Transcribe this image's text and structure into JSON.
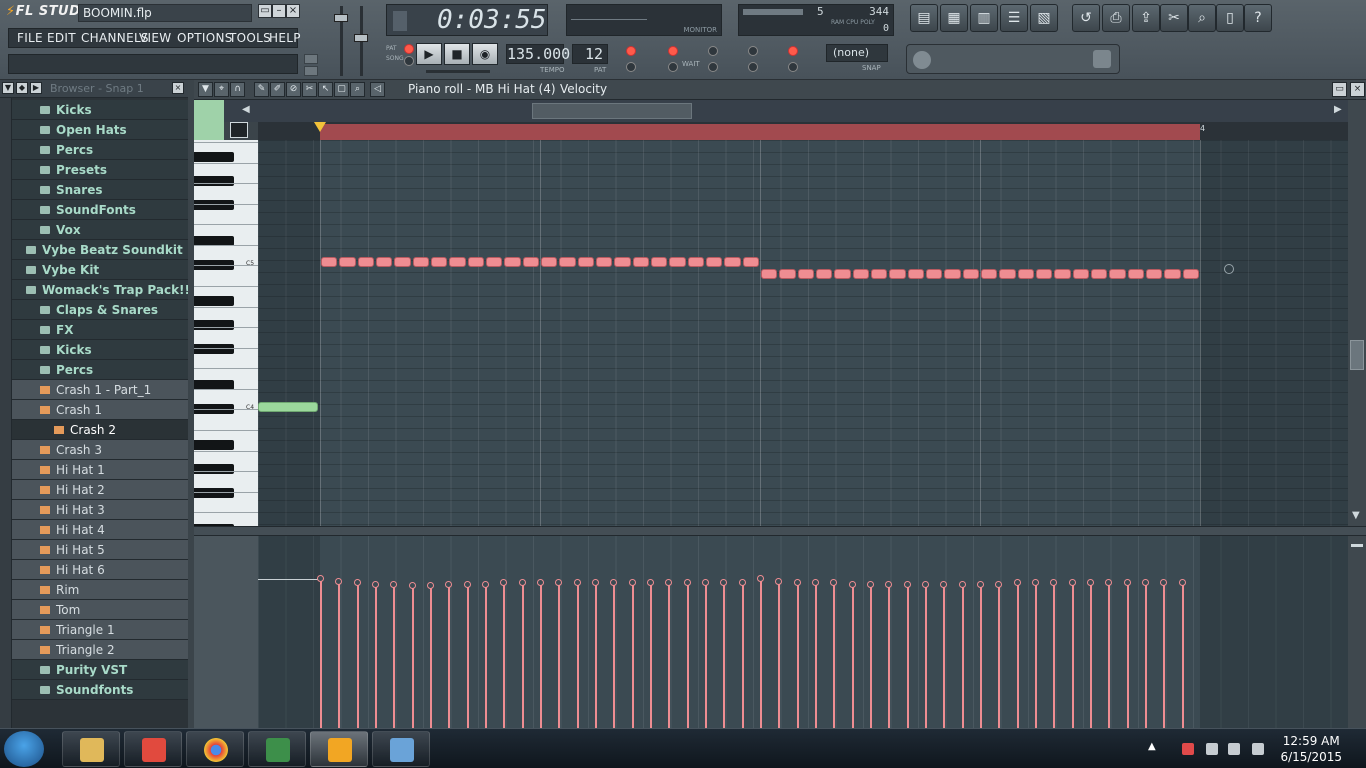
{
  "app": {
    "logo": "FL STUDIO",
    "project_title": "BOOMIN.flp",
    "window_controls": [
      "▭",
      "–",
      "×"
    ]
  },
  "menu": [
    "FILE",
    "EDIT",
    "CHANNELS",
    "VIEW",
    "OPTIONS",
    "TOOLS",
    "HELP"
  ],
  "display": {
    "time": "0:03:55",
    "monitor_label": "MONITOR",
    "cpu_value1": "5",
    "cpu_value2": "344",
    "cpu_value3": "0",
    "cpu_labels": "RAM  CPU  POLY"
  },
  "transport": {
    "modes": [
      "PAT",
      "SONG"
    ],
    "tempo": "135.000",
    "tempo_label": "TEMPO",
    "pattern": "12",
    "pattern_label": "PAT",
    "snap": "(none)",
    "snap_label": "SNAP",
    "wait_label": "WAIT"
  },
  "browser": {
    "title": "Browser - Snap 1",
    "items": [
      {
        "label": "Kicks",
        "type": "folder",
        "indent": 2
      },
      {
        "label": "Open Hats",
        "type": "folder",
        "indent": 2
      },
      {
        "label": "Percs",
        "type": "folder",
        "indent": 2
      },
      {
        "label": "Presets",
        "type": "folder",
        "indent": 2
      },
      {
        "label": "Snares",
        "type": "folder",
        "indent": 2
      },
      {
        "label": "SoundFonts",
        "type": "folder",
        "indent": 2
      },
      {
        "label": "Vox",
        "type": "folder",
        "indent": 2
      },
      {
        "label": "Vybe Beatz Soundkit",
        "type": "folder",
        "indent": 1
      },
      {
        "label": "Vybe Kit",
        "type": "folder",
        "indent": 1
      },
      {
        "label": "Womack's Trap Pack!!!",
        "type": "folder",
        "indent": 1
      },
      {
        "label": "Claps & Snares",
        "type": "folder",
        "indent": 2
      },
      {
        "label": "FX",
        "type": "folder",
        "indent": 2
      },
      {
        "label": "Kicks",
        "type": "folder",
        "indent": 2
      },
      {
        "label": "Percs",
        "type": "folder",
        "indent": 2
      },
      {
        "label": "Crash 1 - Part_1",
        "type": "file",
        "indent": 2
      },
      {
        "label": "Crash 1",
        "type": "file",
        "indent": 2
      },
      {
        "label": "Crash 2",
        "type": "file",
        "indent": 3,
        "selected": true
      },
      {
        "label": "Crash 3",
        "type": "file",
        "indent": 2
      },
      {
        "label": "Hi Hat 1",
        "type": "file",
        "indent": 2
      },
      {
        "label": "Hi Hat 2",
        "type": "file",
        "indent": 2
      },
      {
        "label": "Hi Hat 3",
        "type": "file",
        "indent": 2
      },
      {
        "label": "Hi Hat 4",
        "type": "file",
        "indent": 2
      },
      {
        "label": "Hi Hat 5",
        "type": "file",
        "indent": 2
      },
      {
        "label": "Hi Hat 6",
        "type": "file",
        "indent": 2
      },
      {
        "label": "Rim",
        "type": "file",
        "indent": 2
      },
      {
        "label": "Tom",
        "type": "file",
        "indent": 2
      },
      {
        "label": "Triangle 1",
        "type": "file",
        "indent": 2
      },
      {
        "label": "Triangle 2",
        "type": "file",
        "indent": 2
      },
      {
        "label": "Purity VST",
        "type": "folder",
        "indent": 2
      },
      {
        "label": "Soundfonts",
        "type": "folder",
        "indent": 2
      }
    ]
  },
  "piano_roll": {
    "title": "Piano roll - MB Hi Hat (4)",
    "target": "Velocity",
    "key_labels": [
      "C5",
      "C4"
    ],
    "timeline_marker": "4",
    "notes_high_count": 24,
    "notes_low_count": 24,
    "velocity_levels": [
      1.0,
      0.98,
      0.97,
      0.96,
      0.96,
      0.95,
      0.95,
      0.96,
      0.96,
      0.96,
      0.97,
      0.97,
      0.97,
      0.97,
      0.97,
      0.97,
      0.97,
      0.97,
      0.97,
      0.97,
      0.97,
      0.97,
      0.97,
      0.97,
      1.0,
      0.98,
      0.97,
      0.97,
      0.97,
      0.96,
      0.96,
      0.96,
      0.96,
      0.96,
      0.96,
      0.96,
      0.96,
      0.96,
      0.97,
      0.97,
      0.97,
      0.97,
      0.97,
      0.97,
      0.97,
      0.97,
      0.97,
      0.97
    ]
  },
  "taskbar": {
    "time": "12:59 AM",
    "date": "6/15/2015",
    "apps": [
      "windows-explorer",
      "mp3-player",
      "chrome",
      "task-manager",
      "fl-studio",
      "paint"
    ]
  },
  "colors": {
    "note": "#ef8d92",
    "ghost_note": "#9bd89c",
    "loop_bar": "#a24a4f",
    "folder_text": "#a8dac8"
  }
}
